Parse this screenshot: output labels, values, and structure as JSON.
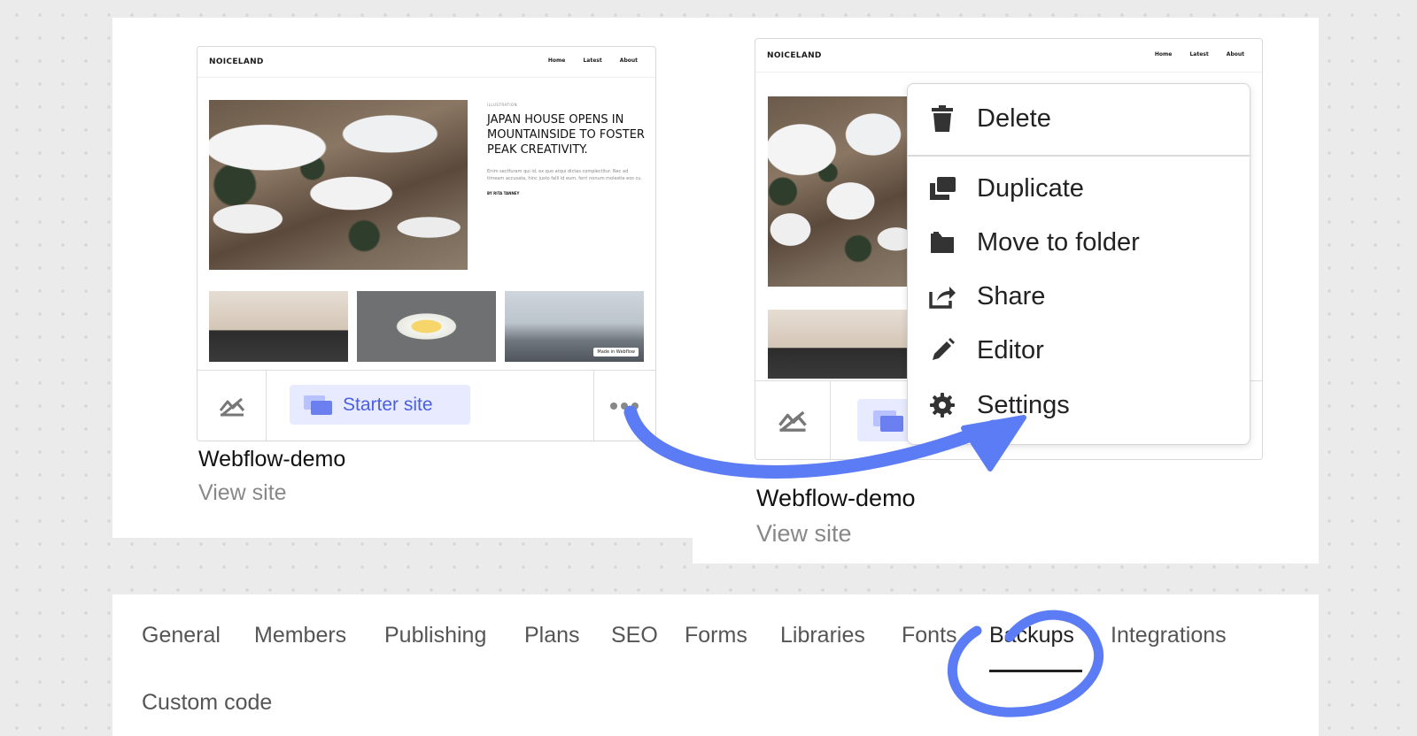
{
  "cards": [
    {
      "preview": {
        "logo": "NOICELAND",
        "nav": [
          "Home",
          "Latest",
          "About"
        ],
        "kicker": "ILLUSTRATION",
        "headline": "JAPAN HOUSE OPENS IN MOUNTAINSIDE TO FOSTER PEAK CREATIVITY.",
        "body": "Enim sectfuram qui id, ex quo atqui dictas complectitur. Nec ad timeam accusata, hinc justo falli id eum, ferri nonum molestie eos cu.",
        "author": "BY RITA TANNEY",
        "badge": "Made in Webflow"
      },
      "badge_label": "Starter site",
      "name": "Webflow-demo",
      "link": "View site"
    },
    {
      "preview": {
        "logo": "NOICELAND",
        "nav": [
          "Home",
          "Latest",
          "About"
        ]
      },
      "name": "Webflow-demo",
      "link": "View site"
    }
  ],
  "context_menu": {
    "items": [
      {
        "label": "Delete",
        "icon": "trash-icon"
      },
      {
        "label": "Duplicate",
        "icon": "duplicate-icon"
      },
      {
        "label": "Move to folder",
        "icon": "folder-icon"
      },
      {
        "label": "Share",
        "icon": "share-icon"
      },
      {
        "label": "Editor",
        "icon": "pencil-icon"
      },
      {
        "label": "Settings",
        "icon": "gear-icon"
      }
    ]
  },
  "settings_tabs": {
    "items": [
      "General",
      "Members",
      "Publishing",
      "Plans",
      "SEO",
      "Forms",
      "Libraries",
      "Fonts",
      "Backups",
      "Integrations",
      "Custom code"
    ],
    "active": "Backups"
  },
  "colors": {
    "accent": "#4a5fe0",
    "annotation": "#5b7cf5",
    "badge_bg": "#e8ebff"
  }
}
